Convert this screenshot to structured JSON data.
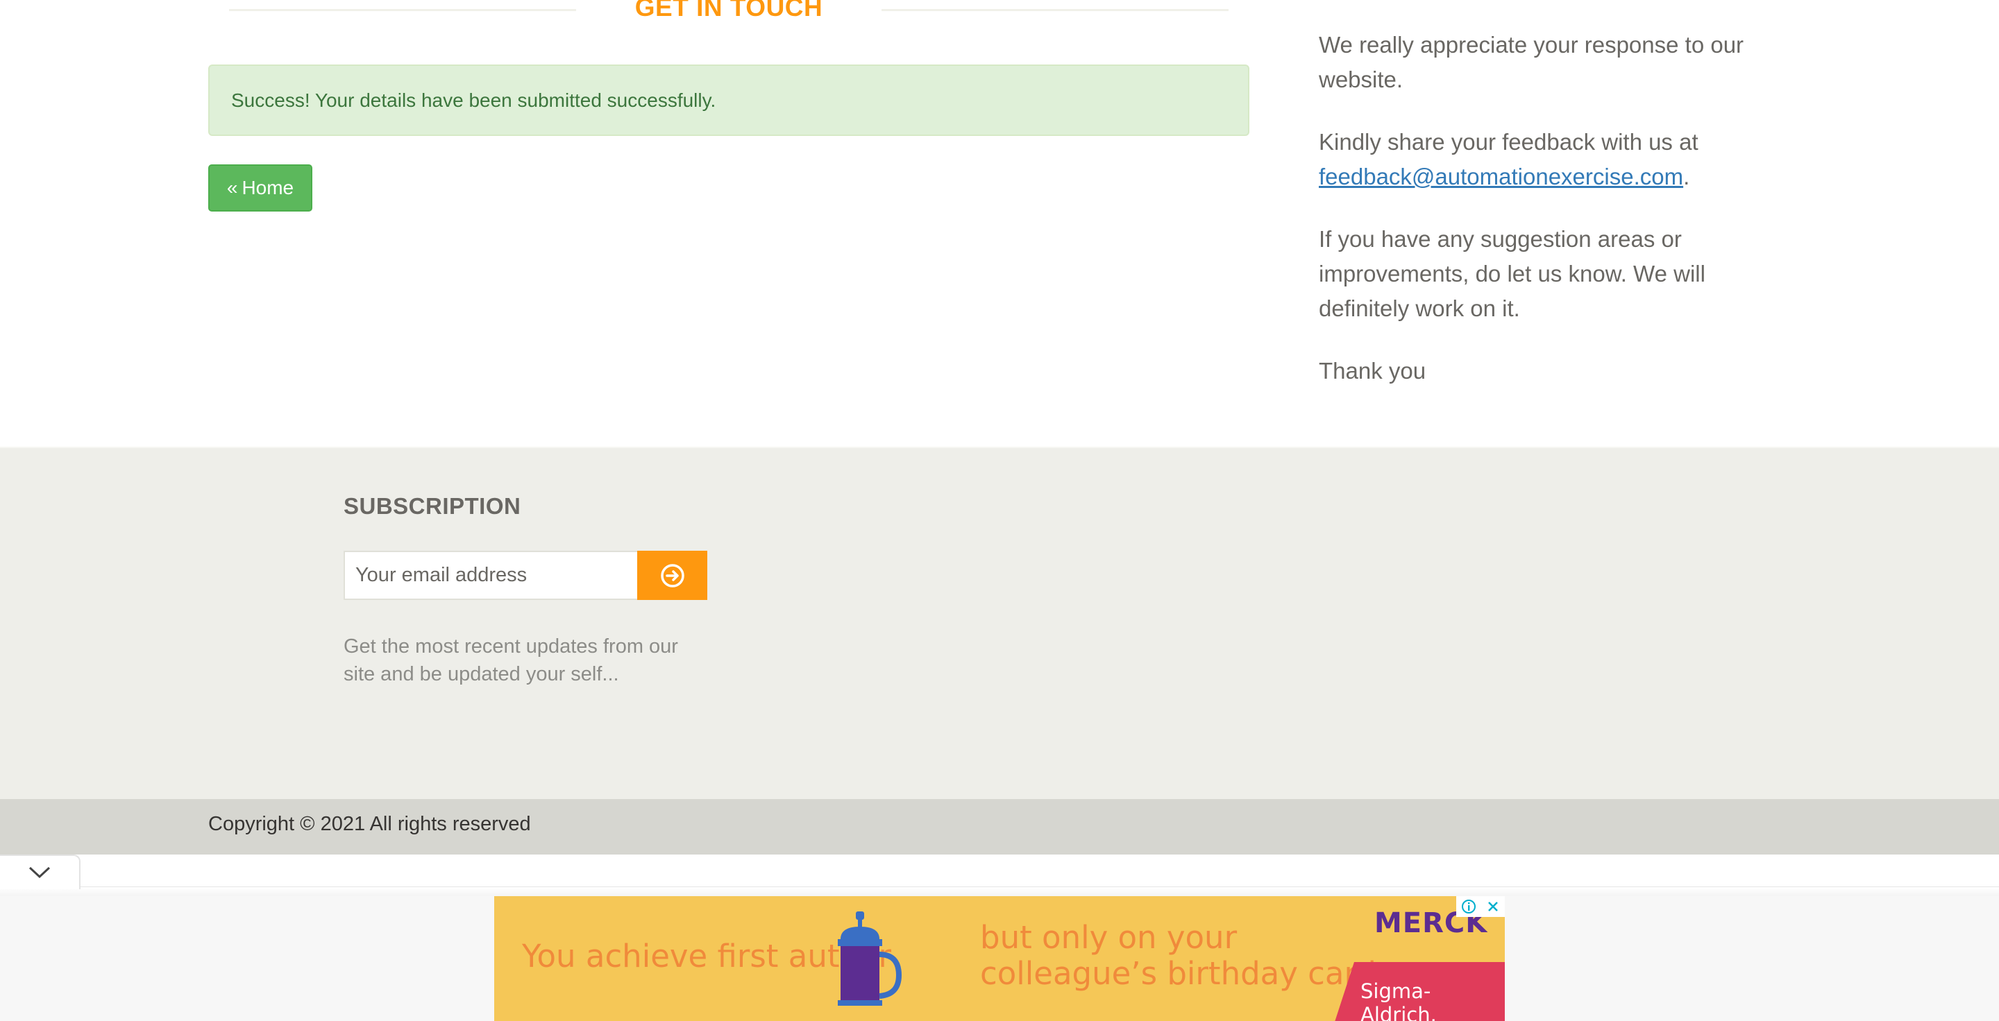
{
  "contact": {
    "title": "GET IN TOUCH",
    "success_message": "Success! Your details have been submitted successfully.",
    "home_button": "Home"
  },
  "feedback": {
    "p1": "We really appreciate your response to our website.",
    "p2_prefix": "Kindly share your feedback with us at",
    "email": "feedback@automationexercise.com",
    "p2_suffix": ".",
    "p3": "If you have any suggestion areas or improvements, do let us know. We will definitely work on it.",
    "p4": "Thank you"
  },
  "subscription": {
    "title": "SUBSCRIPTION",
    "placeholder": "Your email address",
    "note": "Get the most recent updates from our site and be updated your self..."
  },
  "footer": {
    "copyright": "Copyright © 2021 All rights reserved"
  },
  "ad": {
    "text_left": "You achieve first author",
    "text_right_line1": "but only on your",
    "text_right_line2": "colleague’s birthday card.",
    "brand": "MERCK",
    "sub_brand": "Sigma-Aldrich."
  },
  "colors": {
    "accent": "#fe980f",
    "success_bg": "#dff0d8",
    "success_text": "#3c763d",
    "home_button": "#5cb85c",
    "link": "#337ab7",
    "footer_bg": "#eeeee9",
    "copyright_bg": "#d6d6d0",
    "ad_bg": "#f5c757"
  },
  "icons": {
    "home_button": "double-chevron-left-icon",
    "subscribe_button": "arrow-circle-right-icon",
    "collapse_tab": "chevron-down-icon",
    "ad_info": "info-icon",
    "ad_close": "close-icon"
  }
}
